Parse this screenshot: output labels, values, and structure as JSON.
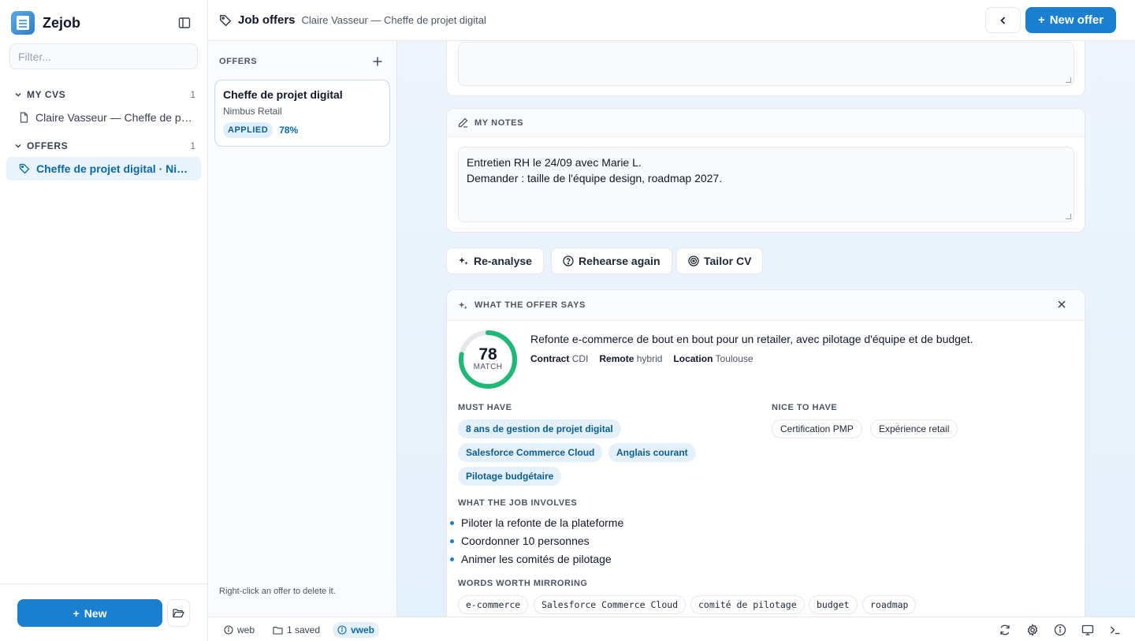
{
  "app": {
    "name": "Zejob"
  },
  "sidebar": {
    "filter_placeholder": "Filter...",
    "sections": [
      {
        "label": "MY CVS",
        "count": "1",
        "items": [
          {
            "label": "Claire Vasseur — Cheffe de projet digital"
          }
        ]
      },
      {
        "label": "OFFERS",
        "count": "1",
        "items": [
          {
            "label": "Cheffe de projet digital · Nimbus Retail"
          }
        ]
      }
    ],
    "new_label": "New"
  },
  "header": {
    "title": "Job offers",
    "subtitle": "Claire Vasseur — Cheffe de projet digital",
    "new_offer_label": "New offer"
  },
  "offers": {
    "heading": "OFFERS",
    "cards": [
      {
        "title": "Cheffe de projet digital",
        "company": "Nimbus Retail",
        "status": "APPLIED",
        "match": "78%"
      }
    ],
    "hint": "Right-click an offer to delete it."
  },
  "notes": {
    "heading": "MY NOTES",
    "line1": "Entretien RH le 24/09 avec Marie L.",
    "line2": "Demander : taille de l'équipe design, roadmap 2027."
  },
  "actions": {
    "reanalyse": "Re-analyse",
    "rehearse": "Rehearse again",
    "tailor": "Tailor CV"
  },
  "analysis": {
    "heading": "WHAT THE OFFER SAYS",
    "score": 78,
    "score_label": "MATCH",
    "summary": "Refonte e-commerce de bout en bout pour un retailer, avec pilotage d'équipe et de budget.",
    "meta": [
      {
        "key": "Contract",
        "value": "CDI"
      },
      {
        "key": "Remote",
        "value": "hybrid"
      },
      {
        "key": "Location",
        "value": "Toulouse"
      }
    ],
    "must_have_heading": "MUST HAVE",
    "must_have": [
      "8 ans de gestion de projet digital",
      "Salesforce Commerce Cloud",
      "Anglais courant",
      "Pilotage budgétaire"
    ],
    "nice_to_have_heading": "NICE TO HAVE",
    "nice_to_have": [
      "Certification PMP",
      "Expérience retail"
    ],
    "involves_heading": "WHAT THE JOB INVOLVES",
    "involves": [
      "Piloter la refonte de la plateforme",
      "Coordonner 10 personnes",
      "Animer les comités de pilotage"
    ],
    "words_heading": "WORDS WORTH MIRRORING",
    "words": [
      "e-commerce",
      "Salesforce Commerce Cloud",
      "comité de pilotage",
      "budget",
      "roadmap"
    ]
  },
  "statusbar": {
    "web": "web",
    "saved": "1 saved",
    "vweb": "vweb"
  },
  "colors": {
    "accent": "#1a7fcf",
    "match_ring": "#1fb877",
    "active_bg": "#e8f3fb"
  }
}
